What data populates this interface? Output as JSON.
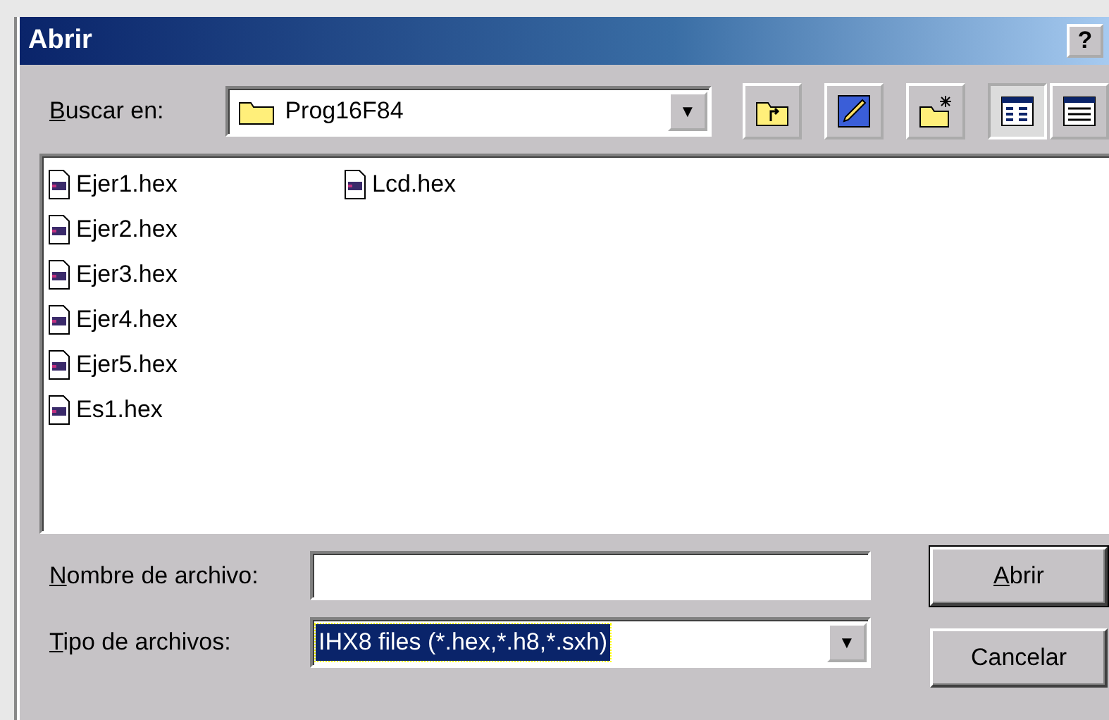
{
  "window": {
    "title": "Abrir",
    "help_button": "?"
  },
  "look_in": {
    "label": "Buscar en:",
    "underline_first": true,
    "value": "Prog16F84",
    "dropdown_arrow": "▼"
  },
  "toolbar": [
    {
      "kind": "up-folder",
      "selected": false
    },
    {
      "kind": "pencil",
      "selected": false
    },
    {
      "kind": "new-folder",
      "selected": false
    },
    {
      "kind": "list-view",
      "selected": true
    },
    {
      "kind": "details-view",
      "selected": false
    }
  ],
  "files": [
    {
      "name": "Ejer1.hex"
    },
    {
      "name": "Ejer2.hex"
    },
    {
      "name": "Ejer3.hex"
    },
    {
      "name": "Ejer4.hex"
    },
    {
      "name": "Ejer5.hex"
    },
    {
      "name": "Es1.hex"
    },
    {
      "name": "Lcd.hex"
    }
  ],
  "file_name": {
    "label": "Nombre de archivo:",
    "underline_first": true
  },
  "file_type": {
    "label": "Tipo de archivos:",
    "underline_first": true,
    "value": "IHX8 files (*.hex,*.h8,*.sxh)",
    "selected": true,
    "dropdown_arrow": "▼"
  },
  "buttons": [
    {
      "label": "Abrir",
      "underline_first": true
    },
    {
      "label": "Cancelar",
      "underline_first": false
    }
  ]
}
